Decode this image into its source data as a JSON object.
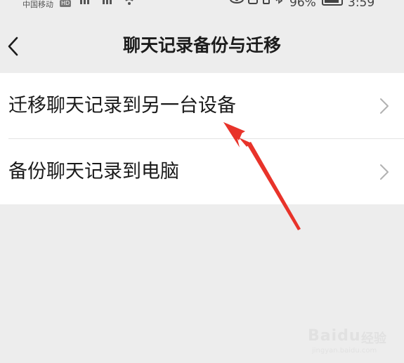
{
  "status_bar": {
    "carrier": "中国移动",
    "hd_badge": "HD",
    "battery_percent": "96%",
    "battery_level": 0.96,
    "time": "3:59"
  },
  "nav": {
    "title": "聊天记录备份与迁移"
  },
  "menu": {
    "items": [
      {
        "label": "迁移聊天记录到另一台设备"
      },
      {
        "label": "备份聊天记录到电脑"
      }
    ]
  },
  "watermark": {
    "brand": "Baidu",
    "suffix": "经验",
    "url": "jingyan.baidu.com"
  },
  "colors": {
    "background": "#ededed",
    "list_background": "#ffffff",
    "annotation_arrow": "#e8332a",
    "chevron": "#b2b2b2"
  }
}
